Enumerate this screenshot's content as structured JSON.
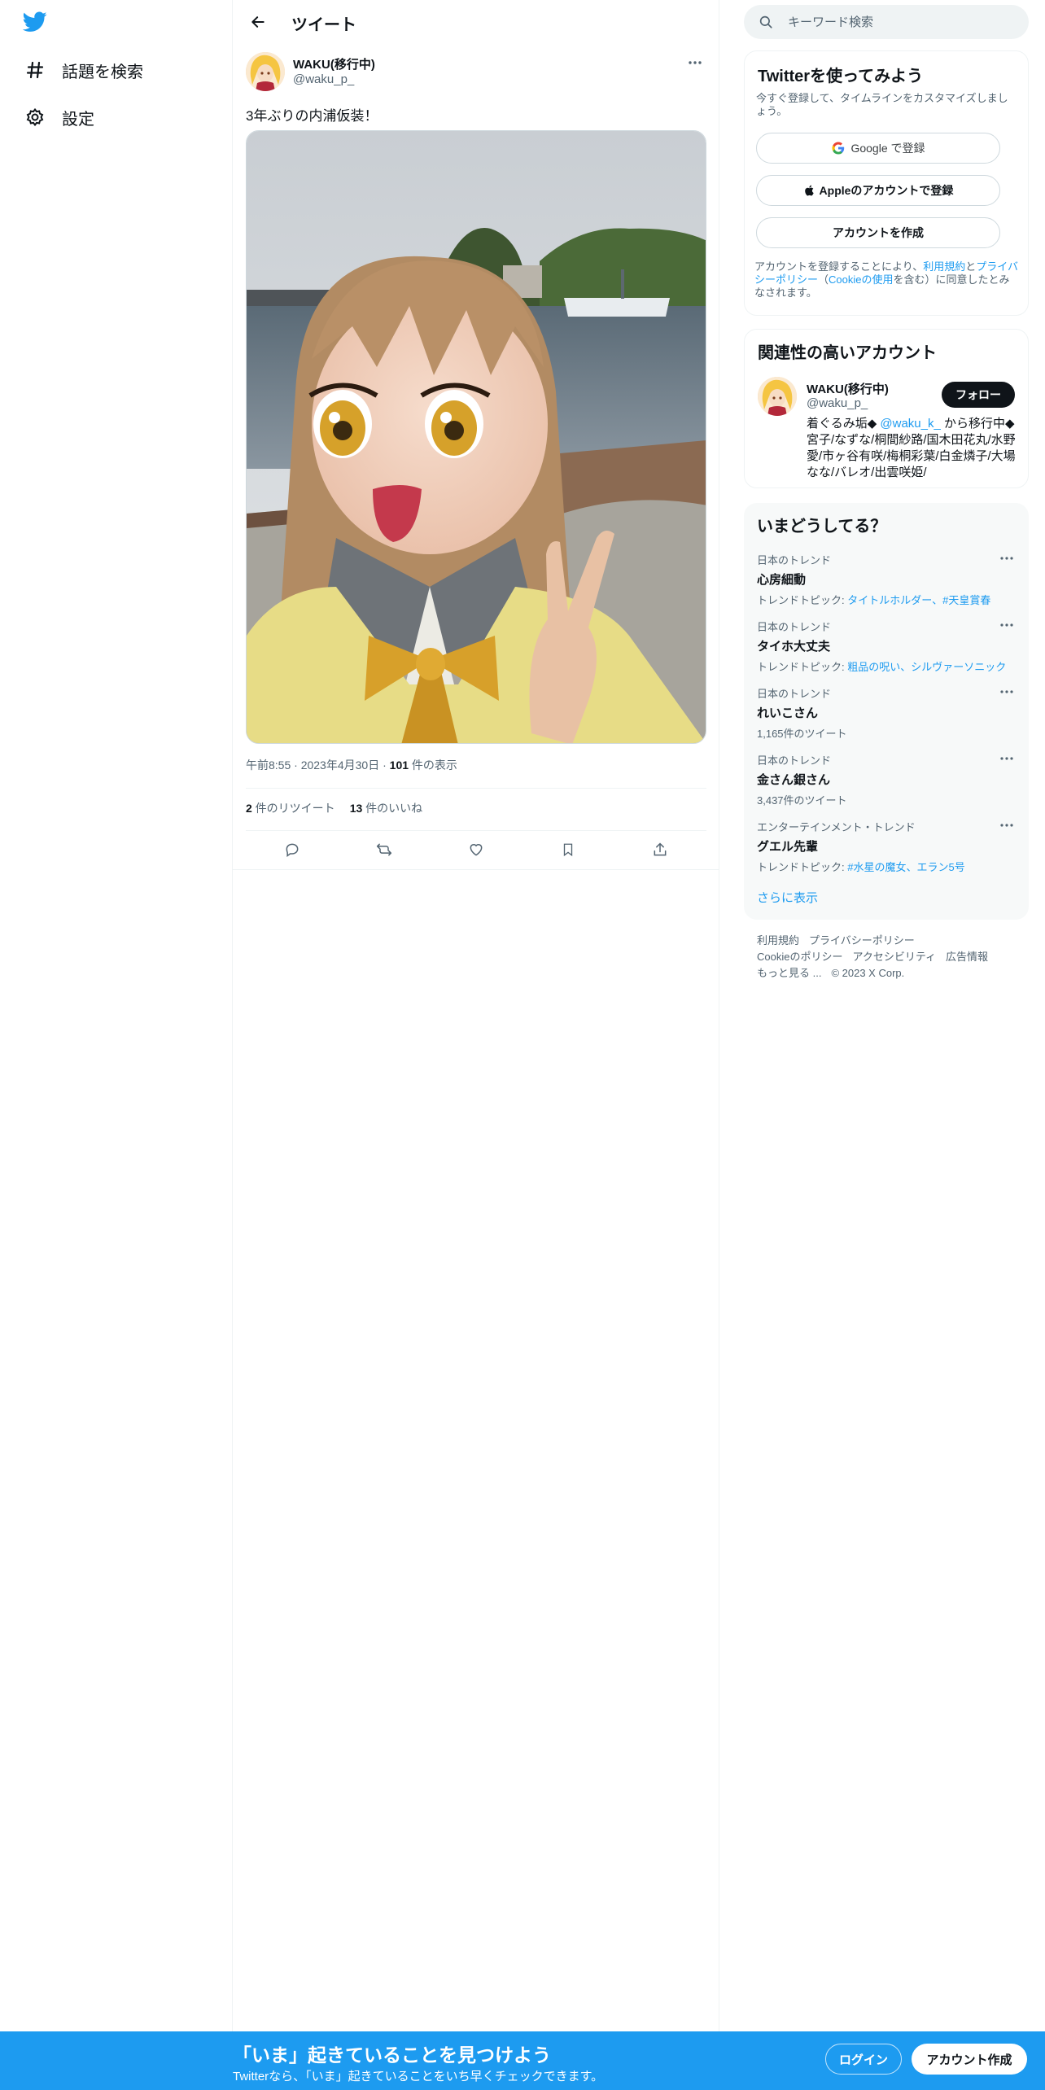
{
  "nav": {
    "items": [
      {
        "label": "話題を検索",
        "icon": "hashtag-icon"
      },
      {
        "label": "設定",
        "icon": "gear-icon"
      }
    ]
  },
  "header": {
    "title": "ツイート"
  },
  "tweet": {
    "author_name": "WAKU(移行中)",
    "author_handle": "@waku_p_",
    "text": "3年ぶりの内浦仮装！",
    "time": "午前8:55",
    "date": "2023年4月30日",
    "views_count": "101",
    "views_label": " 件の表示",
    "retweets_count": "2",
    "retweets_label": " 件のリツイート",
    "likes_count": "13",
    "likes_label": " 件のいいね"
  },
  "search": {
    "placeholder": "キーワード検索"
  },
  "signup_card": {
    "title": "Twitterを使ってみよう",
    "subtitle": "今すぐ登録して、タイムラインをカスタマイズしましょう。",
    "google_label": "Google で登録",
    "apple_label": "Appleのアカウントで登録",
    "create_label": "アカウントを作成",
    "legal_pre": "アカウントを登録することにより、",
    "legal_terms": "利用規約",
    "legal_and": "と",
    "legal_privacy": "プライバシーポリシー",
    "legal_paren_open": "（",
    "legal_cookie": "Cookieの使用",
    "legal_post": "を含む）に同意したとみなされます。"
  },
  "who_card": {
    "title": "関連性の高いアカウント",
    "name": "WAKU(移行中)",
    "handle": "@waku_p_",
    "follow_label": "フォロー",
    "bio_pre": "着ぐるみ垢◆ ",
    "bio_link": "@waku_k_",
    "bio_post": " から移行中◆宮子/なずな/桐間紗路/国木田花丸/水野愛/市ヶ谷有咲/梅桐彩葉/白金燐子/大場なな/バレオ/出雲咲姫/"
  },
  "trends": {
    "title": "いまどうしてる？",
    "items": [
      {
        "category": "日本のトレンド",
        "name": "心房細動",
        "sub_pre": "トレンドトピック: ",
        "sub_link": "タイトルホルダー、#天皇賞春"
      },
      {
        "category": "日本のトレンド",
        "name": "タイホ大丈夫",
        "sub_pre": "トレンドトピック: ",
        "sub_link": "粗品の呪い、シルヴァーソニック"
      },
      {
        "category": "日本のトレンド",
        "name": "れいこさん",
        "sub_pre": "1,165件のツイート",
        "sub_link": ""
      },
      {
        "category": "日本のトレンド",
        "name": "金さん銀さん",
        "sub_pre": "3,437件のツイート",
        "sub_link": ""
      },
      {
        "category": "エンターテインメント・トレンド",
        "name": "グエル先輩",
        "sub_pre": "トレンドトピック: ",
        "sub_link": "#水星の魔女、エラン5号"
      }
    ],
    "show_more": "さらに表示"
  },
  "footer": {
    "links": [
      "利用規約",
      "プライバシーポリシー",
      "Cookieのポリシー",
      "アクセシビリティ",
      "広告情報",
      "もっと見る ..."
    ],
    "copyright": "© 2023 X Corp."
  },
  "banner": {
    "title": "「いま」起きていることを見つけよう",
    "subtitle": "Twitterなら、「いま」起きていることをいち早くチェックできます。",
    "login_label": "ログイン",
    "signup_label": "アカウント作成"
  },
  "colors": {
    "accent": "#1d9bf0",
    "text": "#0f1419",
    "secondary": "#536471",
    "border": "#eff3f4"
  }
}
